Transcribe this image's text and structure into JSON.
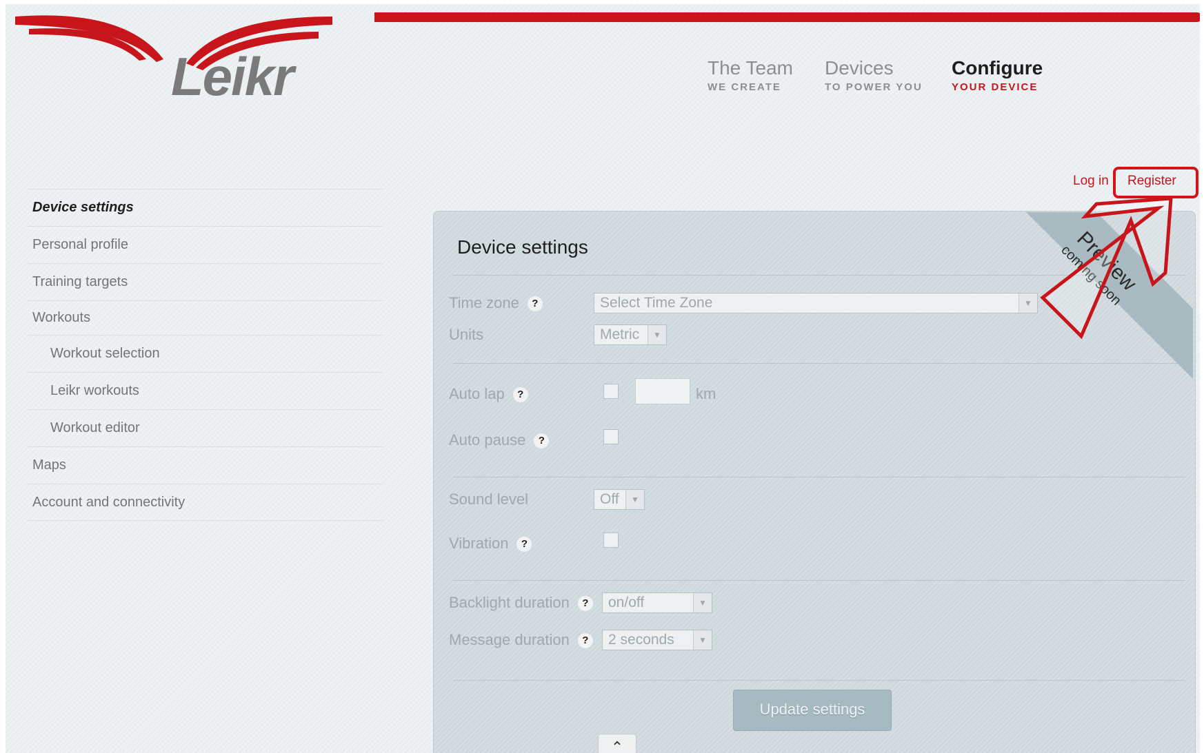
{
  "brand": {
    "name": "Leikr",
    "accent": "#c8141b"
  },
  "nav": [
    {
      "main": "The Team",
      "sub": "WE CREATE",
      "active": false
    },
    {
      "main": "Devices",
      "sub": "TO POWER YOU",
      "active": false
    },
    {
      "main": "Configure",
      "sub": "YOUR DEVICE",
      "active": true
    }
  ],
  "auth": {
    "login": "Log in",
    "register": "Register"
  },
  "sidebar": {
    "items": [
      {
        "label": "Device settings"
      },
      {
        "label": "Personal profile"
      },
      {
        "label": "Training targets"
      },
      {
        "label": "Workouts"
      },
      {
        "label": "Workout selection"
      },
      {
        "label": "Leikr workouts"
      },
      {
        "label": "Workout editor"
      },
      {
        "label": "Maps"
      },
      {
        "label": "Account and connectivity"
      }
    ]
  },
  "panel": {
    "title": "Device settings",
    "ribbon": {
      "main": "Preview",
      "sub": "coming soon"
    },
    "fields": {
      "time_zone": {
        "label": "Time zone",
        "value": "Select Time Zone"
      },
      "units": {
        "label": "Units",
        "value": "Metric"
      },
      "auto_lap": {
        "label": "Auto lap",
        "unit": "km",
        "value": ""
      },
      "auto_pause": {
        "label": "Auto pause"
      },
      "sound_level": {
        "label": "Sound level",
        "value": "Off"
      },
      "vibration": {
        "label": "Vibration"
      },
      "backlight_duration": {
        "label": "Backlight duration",
        "value": "on/off"
      },
      "message_duration": {
        "label": "Message duration",
        "value": "2 seconds"
      }
    },
    "help_glyph": "?",
    "update_label": "Update settings",
    "back_to_top_glyph": "⌃"
  }
}
